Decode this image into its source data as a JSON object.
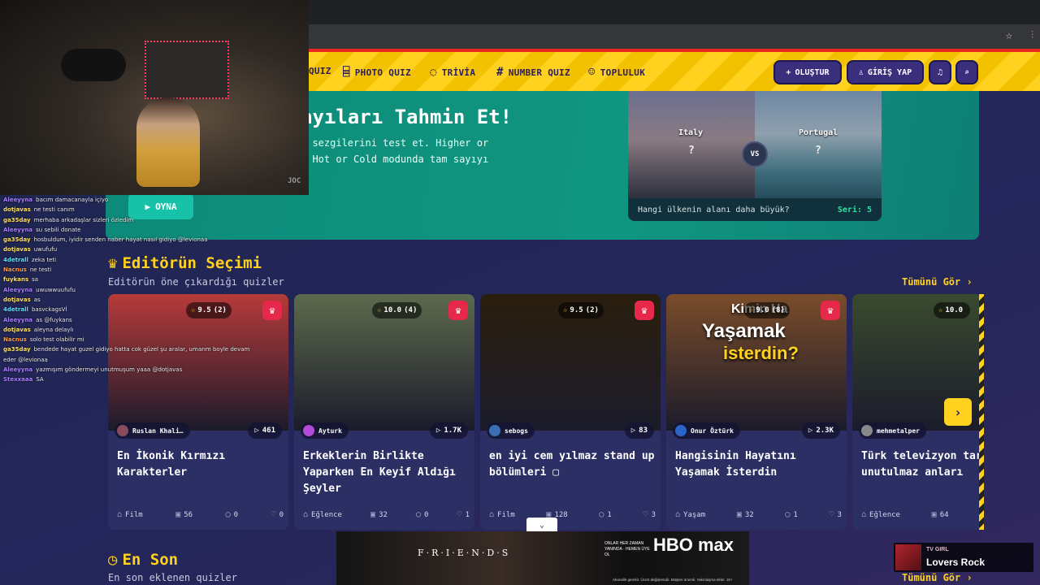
{
  "browser": {
    "star_icon": "☆",
    "menu_icon": "⫶"
  },
  "nav": {
    "items": [
      {
        "label": "QUIZ",
        "icon": "quiz-icon"
      },
      {
        "label": "PHOTO QUIZ",
        "icon": "camera-icon"
      },
      {
        "label": "TRİVİA",
        "icon": "chat-question-icon"
      },
      {
        "label": "NUMBER QUIZ",
        "icon": "hash-icon"
      },
      {
        "label": "TOPLULUK",
        "icon": "users-icon"
      }
    ],
    "create_label": "OLUŞTUR",
    "login_label": "GİRİŞ YAP"
  },
  "hero": {
    "title": "ayıları Tahmin Et!",
    "line1": "a sezgilerini test et. Higher or",
    "line2": "a Hot or Cold modunda tam sayıyı",
    "play_label": "OYNA",
    "compare": {
      "left": "Italy",
      "right": "Portugal",
      "mark": "?",
      "vs": "VS",
      "question": "Hangi ülkenin alanı daha büyük?",
      "streak": "Seri: 5"
    }
  },
  "editors": {
    "title": "Editörün Seçimi",
    "subtitle": "Editörün öne çıkardığı quizler",
    "see_all": "Tümünü Gör",
    "cards": [
      {
        "rating": "9.5",
        "votes": "(2)",
        "author": "Ruslan Khali…",
        "plays": "461",
        "title": "En İkonik Kırmızı Karakterler",
        "category": "Film",
        "questions": "56",
        "comments": "0",
        "likes": "0",
        "thumb": "#b63a3a",
        "avatar": "#8a4b5d"
      },
      {
        "rating": "10.0",
        "votes": "(4)",
        "author": "Ayturk",
        "plays": "1.7K",
        "title": "Erkeklerin Birlikte Yaparken En Keyif Aldığı Şeyler",
        "category": "Eğlence",
        "questions": "32",
        "comments": "0",
        "likes": "1",
        "thumb": "#5d6a4d",
        "avatar": "#b24bd8"
      },
      {
        "rating": "9.5",
        "votes": "(2)",
        "author": "sebogs",
        "plays": "83",
        "title": "en iyi cem yılmaz stand up bölümleri ▢",
        "category": "Film",
        "questions": "128",
        "comments": "1",
        "likes": "3",
        "thumb": "#2a1e0d",
        "avatar": "#3b6fb3"
      },
      {
        "rating": "9.0",
        "votes": "(8)",
        "author": "Onur Öztürk",
        "plays": "2.3K",
        "title": "Hangisinin Hayatını Yaşamak İsterdin",
        "category": "Yaşam",
        "questions": "32",
        "comments": "1",
        "likes": "3",
        "thumb": "#7a4c2a",
        "avatar": "#2b64c9",
        "overlay1": "Kimin Ha",
        "overlay2": "Yaşamak",
        "overlay3": "isterdin?"
      },
      {
        "rating": "10.0",
        "votes": "",
        "author": "mehmetalper",
        "plays": "",
        "title": "Türk televizyon tarihinin unutulmaz anları",
        "category": "Eğlence",
        "questions": "64",
        "comments": "",
        "likes": "",
        "thumb": "#3a4a2f",
        "avatar": "#888"
      }
    ]
  },
  "latest": {
    "title": "En Son",
    "subtitle": "En son eklenen quizler",
    "see_all": "Tümünü Gör"
  },
  "stream": {
    "cam_tag": "JOC",
    "chat": [
      {
        "user": "Aleeyyna",
        "color": "#a77cff",
        "msg": "bacım damacanayla içiyo"
      },
      {
        "user": "dotjavas",
        "color": "#ffe05a",
        "msg": "ne testi canım"
      },
      {
        "user": "ga35day",
        "color": "#ffe05a",
        "msg": "merhaba arkadaşlar sizleri özledim"
      },
      {
        "user": "Aleeyyna",
        "color": "#a77cff",
        "msg": "su sebili donate"
      },
      {
        "user": "ga35day",
        "color": "#ffe05a",
        "msg": "hosbuldum, iyidir senden naber hayat nasıl gidiyo @levionaa"
      },
      {
        "user": "dotjavas",
        "color": "#ffe05a",
        "msg": "uwufufu"
      },
      {
        "user": "4detrall",
        "color": "#5ae0ff",
        "msg": "zeka teti"
      },
      {
        "user": "Nacnus",
        "color": "#ff9a3c",
        "msg": "ne testi"
      },
      {
        "user": "fuykans",
        "color": "#ffe05a",
        "msg": "sa"
      },
      {
        "user": "Aleeyyna",
        "color": "#a77cff",
        "msg": "uwuwwuufufu"
      },
      {
        "user": "dotjavas",
        "color": "#ffe05a",
        "msg": "as"
      },
      {
        "user": "4detrall",
        "color": "#5ae0ff",
        "msg": "basvckagsVİ"
      },
      {
        "user": "Aleeyyna",
        "color": "#a77cff",
        "msg": "as @fuykans"
      },
      {
        "user": "dotjavas",
        "color": "#ffe05a",
        "msg": "aleyna delaylı"
      },
      {
        "user": "Nacnus",
        "color": "#ff9a3c",
        "msg": "solo test olabilir mi"
      },
      {
        "user": "ga35day",
        "color": "#ffe05a",
        "msg": "bendede hayat guzel gidiyo hatta cok güzel şu aralar, umarım boyle devam eder @levionaa"
      },
      {
        "user": "Aleeyyna",
        "color": "#a77cff",
        "msg": "yazmışım göndermeyi unutmuşum yaaa @dotjavas"
      },
      {
        "user": "Stexxaaa",
        "color": "#a77cff",
        "msg": "SA"
      }
    ]
  },
  "ad": {
    "friends": "F·R·I·E·N·D·S",
    "hbo": "HBO max",
    "small": "ONLAR HER ZAMAN YANINDA · HEMEN ÜYE OL",
    "fine": "Abonelik gerekir. Ücret değişkendir. Müşteri önemli. Yakınlaşma ekler. 18+"
  },
  "music": {
    "artist": "TV GIRL",
    "track": "Lovers Rock"
  }
}
